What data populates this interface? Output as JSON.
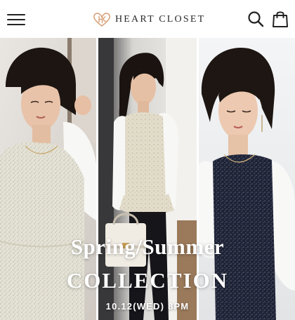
{
  "header": {
    "brand": "HEART CLOSET",
    "menu_icon": "hamburger-menu-icon",
    "logo_icon": "heart-logo-icon",
    "search_icon": "search-icon",
    "cart_icon": "shopping-bag-icon"
  },
  "hero": {
    "headline_line1": "Spring/Summer",
    "headline_line2": "COLLECTION",
    "date": "10.12(WED) 8PM"
  },
  "colors": {
    "header_bg": "#ffffff",
    "text_dark": "#222222",
    "logo_accent": "#d9a27a",
    "hero_text": "#ffffff"
  }
}
